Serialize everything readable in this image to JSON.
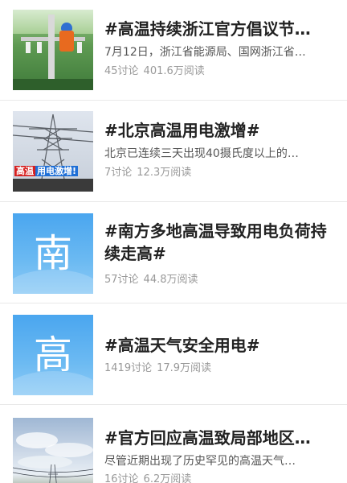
{
  "items": [
    {
      "title": "#高温持续浙江官方倡议节…",
      "description": "7月12日，浙江省能源局、国网浙江省…",
      "discussions": "45讨论",
      "reads": "401.6万阅读",
      "thumb_icon": "worker-on-pole-image"
    },
    {
      "title": "#北京高温用电激增#",
      "description": "北京已连续三天出现40摄氏度以上的…",
      "discussions": "7讨论",
      "reads": "12.3万阅读",
      "thumb_icon": "power-tower-image",
      "thumb_caption_red": "高温",
      "thumb_caption_blue": "用电激增!"
    },
    {
      "title": "#南方多地高温导致用电负荷持续走高#",
      "description": "",
      "discussions": "57讨论",
      "reads": "44.8万阅读",
      "thumb_icon": "character-tile",
      "thumb_glyph": "南"
    },
    {
      "title": "#高温天气安全用电#",
      "description": "",
      "discussions": "1419讨论",
      "reads": "17.9万阅读",
      "thumb_icon": "character-tile",
      "thumb_glyph": "高"
    },
    {
      "title": "#官方回应高温致局部地区…",
      "description": "尽管近期出现了历史罕见的高温天气…",
      "discussions": "16讨论",
      "reads": "6.2万阅读",
      "thumb_icon": "sky-power-lines-image"
    }
  ],
  "colors": {
    "title": "#222222",
    "description": "#555555",
    "meta": "#999999",
    "tile_blue": "#4aa6ef",
    "separator": "#e9e9e9"
  }
}
